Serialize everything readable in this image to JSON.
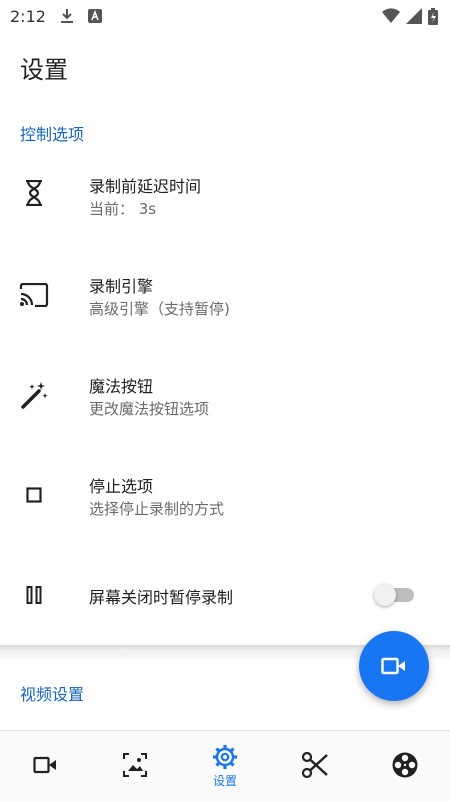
{
  "status_bar": {
    "time": "2:12",
    "icons": [
      "download-icon",
      "a-badge-icon",
      "wifi-icon",
      "signal-icon",
      "battery-icon"
    ]
  },
  "header": {
    "title": "设置"
  },
  "sections": [
    {
      "header": "控制选项"
    },
    {
      "header": "视频设置"
    }
  ],
  "control_items": [
    {
      "icon": "hourglass-icon",
      "title": "录制前延迟时间",
      "summary": "当前： 3s"
    },
    {
      "icon": "cast-icon",
      "title": "录制引擎",
      "summary": "高级引擎（支持暂停)"
    },
    {
      "icon": "magic-wand-icon",
      "title": "魔法按钮",
      "summary": "更改魔法按钮选项"
    },
    {
      "icon": "stop-icon",
      "title": "停止选项",
      "summary": "选择停止录制的方式"
    },
    {
      "icon": "pause-icon",
      "title": "屏幕关闭时暂停录制",
      "summary": "",
      "toggle": false
    }
  ],
  "fab": {
    "icon": "videocam-icon"
  },
  "bottom_nav": {
    "items": [
      {
        "icon": "videocam-icon",
        "label": ""
      },
      {
        "icon": "image-icon",
        "label": ""
      },
      {
        "icon": "gear-icon",
        "label": "设置",
        "selected": true
      },
      {
        "icon": "scissors-icon",
        "label": ""
      },
      {
        "icon": "film-reel-icon",
        "label": ""
      }
    ]
  },
  "colors": {
    "accent": "#1976f2",
    "section_header": "#1565c0",
    "toggle_off": "#bdbdbd"
  }
}
